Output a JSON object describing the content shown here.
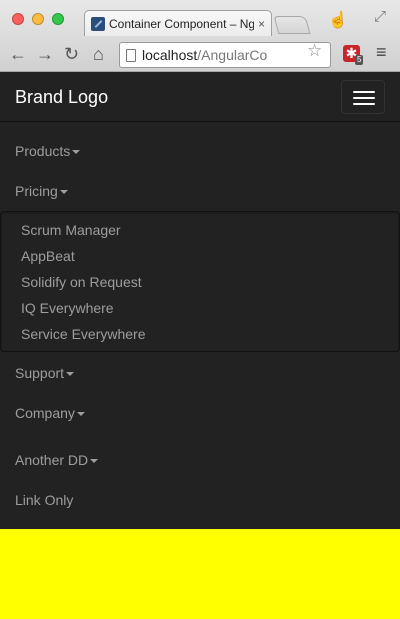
{
  "browser": {
    "tab_title": "Container Component – Ng",
    "tab_close": "×",
    "url_host": "localhost",
    "url_path": "/AngularCo",
    "ext_badge": "5",
    "icons": {
      "back": "arrow-left",
      "forward": "arrow-right",
      "reload": "reload",
      "home": "home",
      "star": "star",
      "menu": "hamburger",
      "cursor": "hand-pointer",
      "fullscreen": "expand"
    }
  },
  "navbar": {
    "brand": "Brand Logo",
    "background": "#222222",
    "link_color": "#9d9d9d",
    "items": [
      {
        "label": "Products",
        "dropdown": true
      },
      {
        "label": "Pricing",
        "dropdown": true,
        "open": true
      },
      {
        "label": "Support",
        "dropdown": true
      },
      {
        "label": "Company",
        "dropdown": true
      },
      {
        "label": "Another DD",
        "dropdown": true
      },
      {
        "label": "Link Only",
        "dropdown": false
      }
    ],
    "pricing_menu": [
      "Scrum Manager",
      "AppBeat",
      "Solidify on Request",
      "IQ Everywhere",
      "Service Everywhere"
    ]
  },
  "page": {
    "background": "#ffff00"
  }
}
